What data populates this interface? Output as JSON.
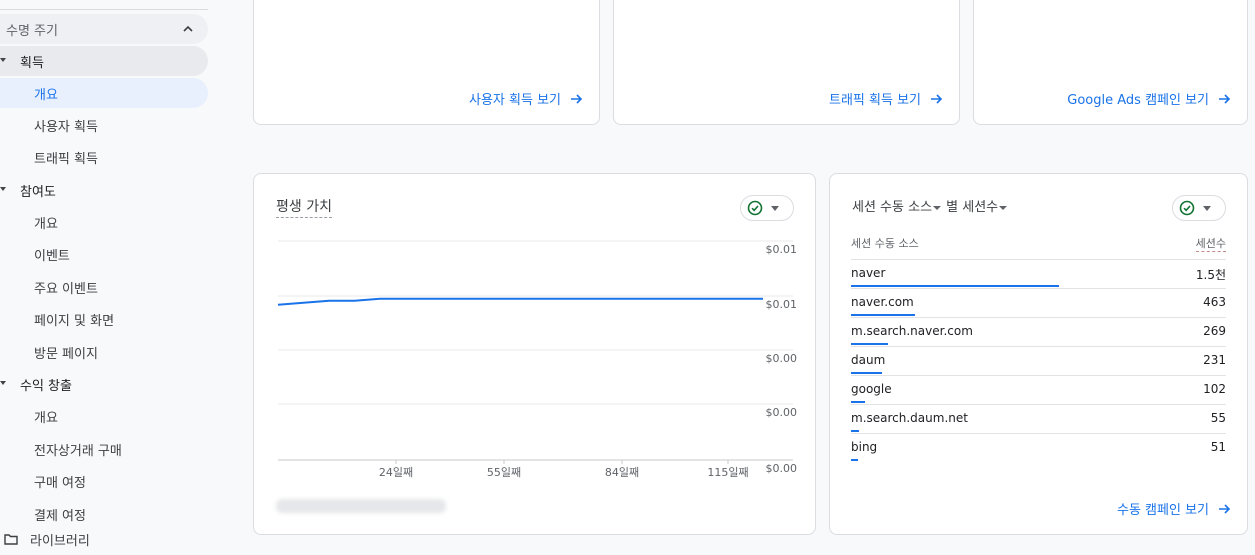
{
  "sidebar": {
    "section_label": "수명 주기",
    "groups": [
      {
        "label": "획득",
        "items": [
          "개요",
          "사용자 획득",
          "트래픽 획득"
        ]
      },
      {
        "label": "참여도",
        "items": [
          "개요",
          "이벤트",
          "주요 이벤트",
          "페이지 및 화면",
          "방문 페이지"
        ]
      },
      {
        "label": "수익 창출",
        "items": [
          "개요",
          "전자상거래 구매",
          "구매 여정",
          "결제 여정"
        ]
      }
    ],
    "library_label": "라이브러리"
  },
  "top_cards": [
    {
      "link": "사용자 획득 보기"
    },
    {
      "link": "트래픽 획득 보기"
    },
    {
      "link": "Google Ads 캠페인 보기"
    }
  ],
  "ltv_card": {
    "title": "평생 가치"
  },
  "chart_data": {
    "type": "line",
    "title": "평생 가치",
    "x_ticks": [
      "24일째",
      "55일째",
      "84일째",
      "115일째"
    ],
    "y_ticks": [
      "$0.01",
      "$0.01",
      "$0.00",
      "$0.00",
      "$0.00"
    ],
    "series": [
      {
        "values": [
          0.0078,
          0.0079,
          0.008,
          0.008,
          0.0081,
          0.0081,
          0.0081,
          0.0081,
          0.0081,
          0.0081,
          0.0081,
          0.0081,
          0.0081,
          0.0081,
          0.0081,
          0.0081,
          0.0081,
          0.0081,
          0.0081,
          0.0081
        ]
      }
    ],
    "ylim": [
      0,
      0.011
    ],
    "grid": true,
    "color": "#1a73e8"
  },
  "session_card": {
    "title_part1": "세션 수동 소스",
    "title_part2": "별 세션수",
    "col_source": "세션 수동 소스",
    "col_sessions": "세션수",
    "rows": [
      {
        "source": "naver",
        "sessions": "1.5천",
        "share": 1.0
      },
      {
        "source": "naver.com",
        "sessions": "463",
        "share": 0.31
      },
      {
        "source": "m.search.naver.com",
        "sessions": "269",
        "share": 0.18
      },
      {
        "source": "daum",
        "sessions": "231",
        "share": 0.15
      },
      {
        "source": "google",
        "sessions": "102",
        "share": 0.068
      },
      {
        "source": "m.search.daum.net",
        "sessions": "55",
        "share": 0.037
      },
      {
        "source": "bing",
        "sessions": "51",
        "share": 0.034
      }
    ],
    "link": "수동 캠페인 보기"
  }
}
